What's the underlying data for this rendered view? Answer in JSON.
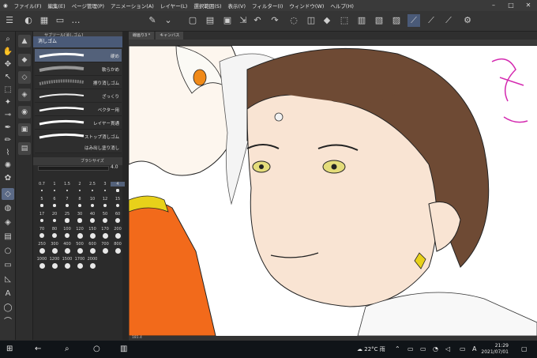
{
  "app": {
    "title": "線画り3 * (5015 x 3541px 350dpi 181.4%) - CLIP STUDIO PAINT EX"
  },
  "menu": [
    {
      "label": "ファイル(F)"
    },
    {
      "label": "編集(E)"
    },
    {
      "label": "ページ管理(P)"
    },
    {
      "label": "アニメーション(A)"
    },
    {
      "label": "レイヤー(L)"
    },
    {
      "label": "選択範囲(S)"
    },
    {
      "label": "表示(V)"
    },
    {
      "label": "フィルター(I)"
    },
    {
      "label": "ウィンドウ(W)"
    },
    {
      "label": "ヘルプ(H)"
    }
  ],
  "subtool": {
    "selected": "消しゴム",
    "header": "サブツール[消しゴム]",
    "brushes": [
      {
        "label": "硬め"
      },
      {
        "label": "軟らかめ"
      },
      {
        "label": "擦り消しゴム"
      },
      {
        "label": "ざっくり"
      },
      {
        "label": "ベクター用"
      },
      {
        "label": "レイヤー貫通"
      },
      {
        "label": "ストップ消しゴム"
      },
      {
        "label": "はみ出し塗り消し"
      }
    ]
  },
  "brush_size": {
    "header": "ブラシサイズ",
    "current": "4.0",
    "sizes": [
      "0.7",
      "1",
      "1.5",
      "2",
      "2.5",
      "3",
      "4",
      "5",
      "6",
      "7",
      "8",
      "10",
      "12",
      "15",
      "17",
      "20",
      "25",
      "30",
      "40",
      "50",
      "60",
      "70",
      "80",
      "100",
      "120",
      "150",
      "170",
      "200",
      "250",
      "300",
      "400",
      "500",
      "600",
      "700",
      "800",
      "1000",
      "1200",
      "1500",
      "1700",
      "2000"
    ]
  },
  "canvas": {
    "tab": "線画り3 *",
    "tab2": "キャンバス",
    "zoom": "181.4"
  },
  "taskbar": {
    "weather": "22°C 雨",
    "time": "21:29",
    "date": "2021/07/01"
  },
  "colors": {
    "accent": "#53617a",
    "fg_color": "#d9b8ad",
    "bg_color": "#ffffff"
  }
}
